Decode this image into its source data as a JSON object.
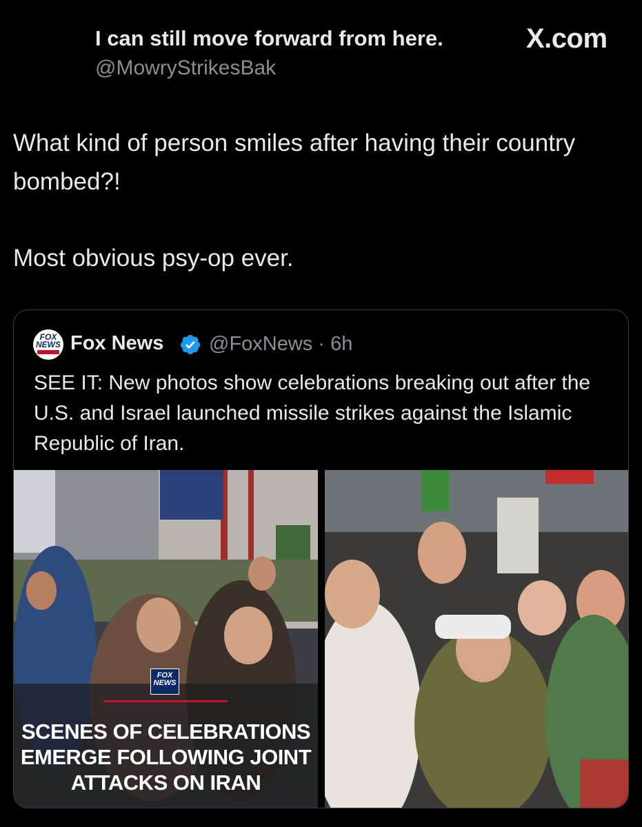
{
  "header": {
    "display_name": "I can still move forward from here.",
    "handle": "@MowryStrikesBak",
    "site_logo": "X.com"
  },
  "post": {
    "line1": "What kind of person smiles after having their country bombed?!",
    "line2": "Most obvious psy-op ever."
  },
  "quote": {
    "avatar_icon": "fox-news-logo-icon",
    "name": "Fox News",
    "badge_icon": "verified-badge-icon",
    "handle_time": "@FoxNews · 6h",
    "text": "SEE IT: New photos show celebrations breaking out after the U.S. and Israel launched missile strikes against the Islamic Republic of Iran.",
    "media": {
      "left_headline": "SCENES OF CELEBRATIONS EMERGE FOLLOWING JOINT ATTACKS ON IRAN"
    }
  },
  "colors": {
    "background": "#000000",
    "text_primary": "#e7e9ea",
    "text_secondary": "#8b8f94",
    "border": "#3b3f44",
    "verified_blue": "#1d9bf0",
    "fox_red": "#c8102e"
  }
}
